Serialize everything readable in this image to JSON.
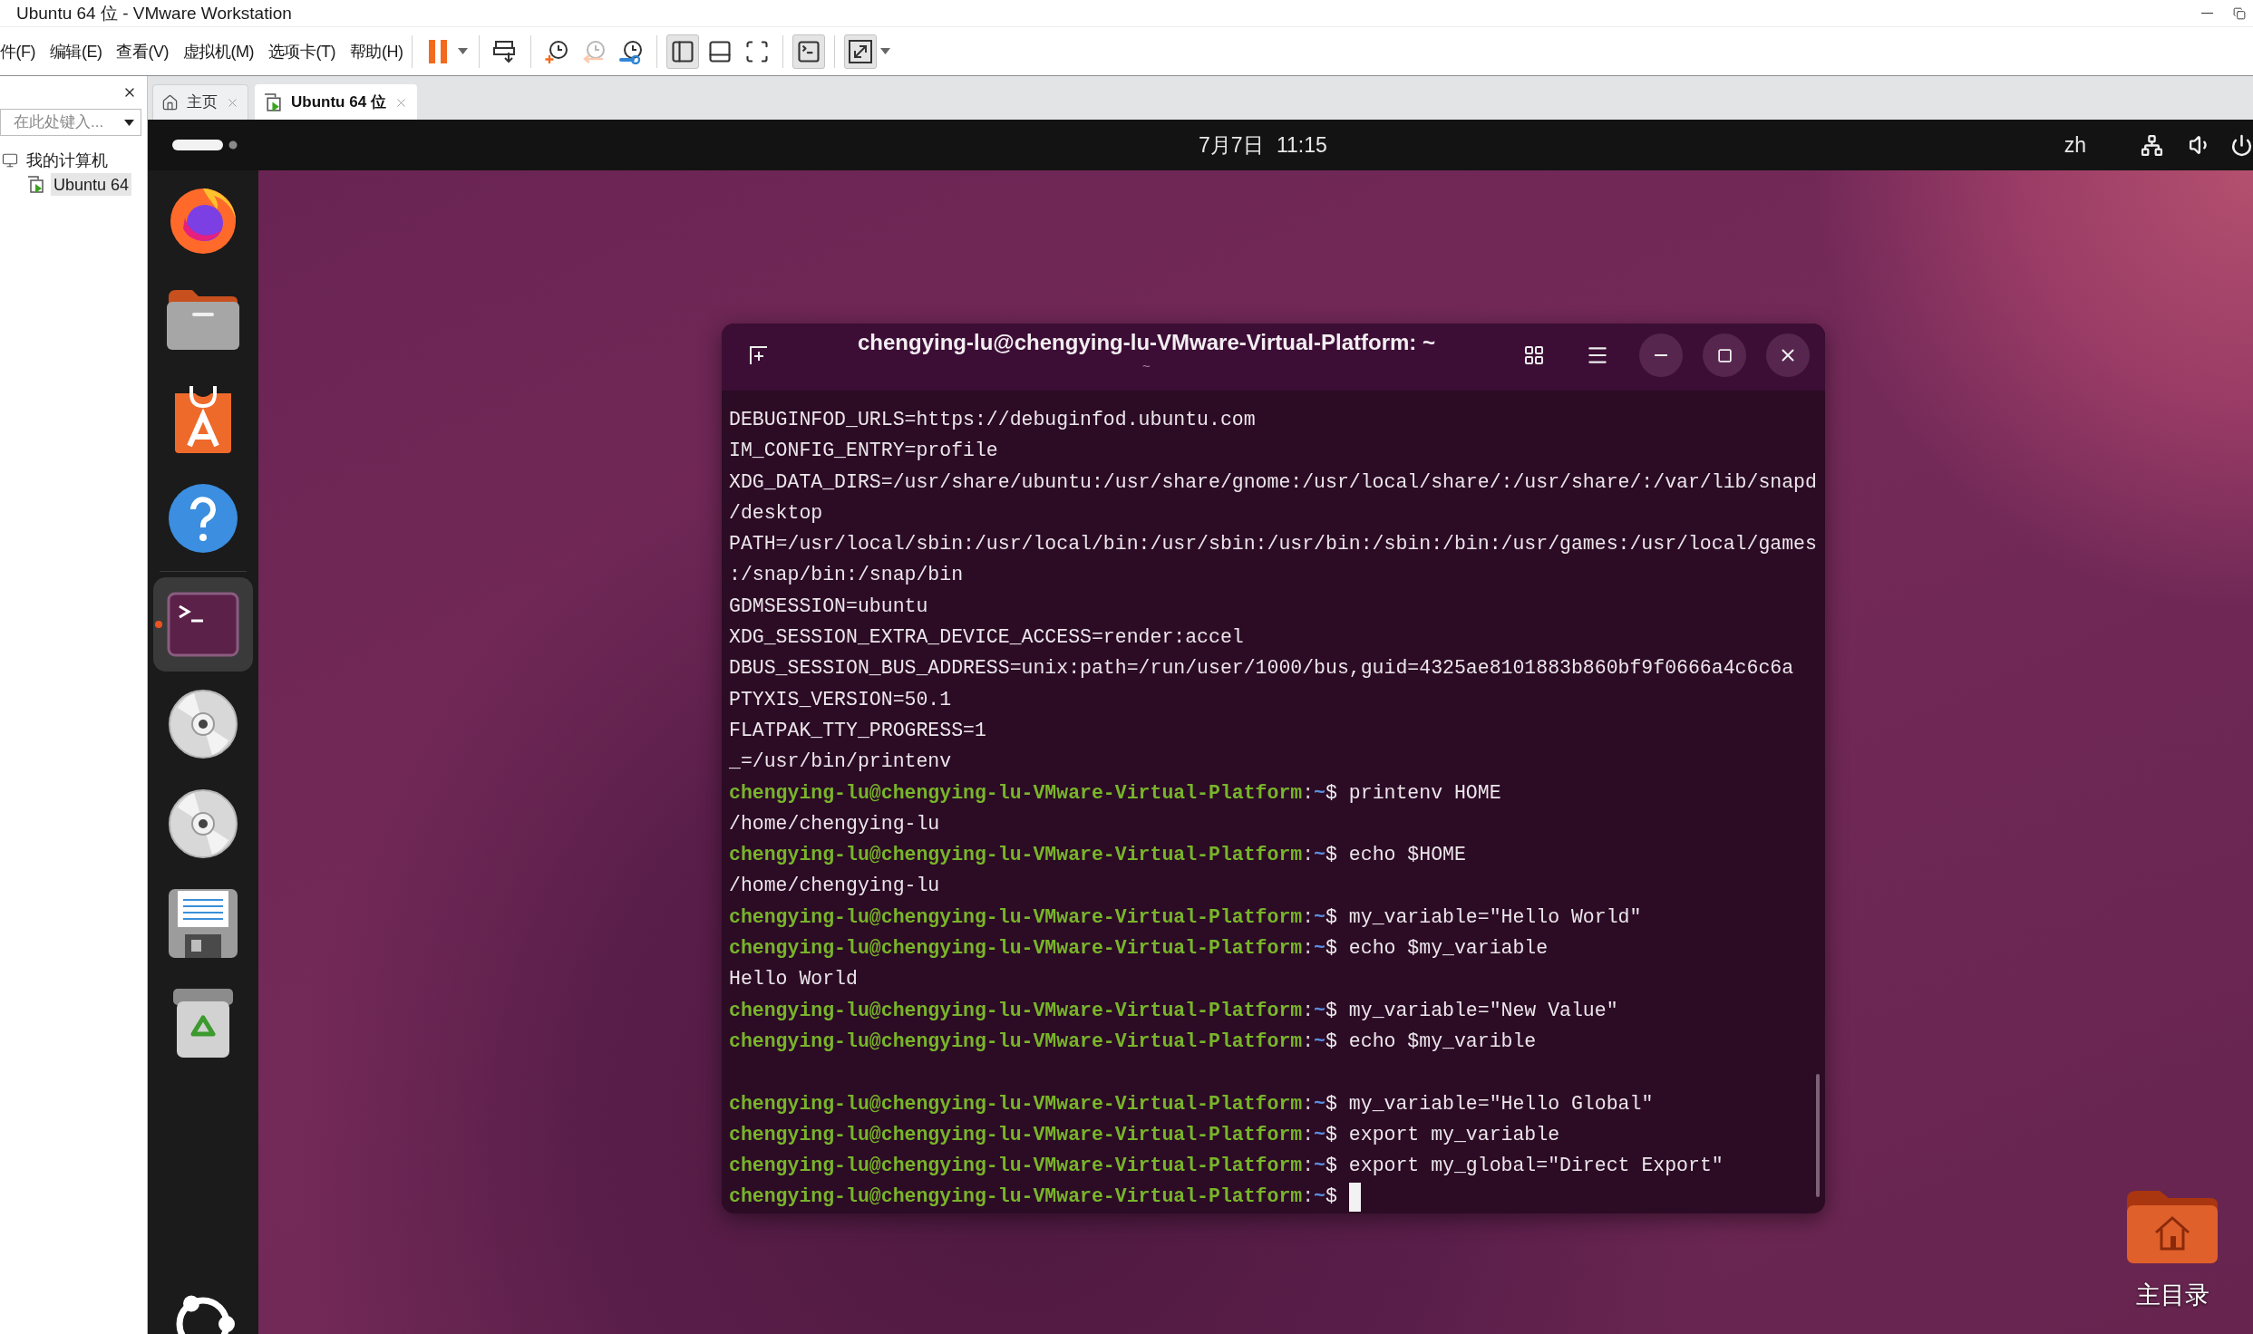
{
  "window": {
    "title": "Ubuntu 64 位 - VMware Workstation"
  },
  "menu": [
    "件(F)",
    "编辑(E)",
    "查看(V)",
    "虚拟机(M)",
    "选项卡(T)",
    "帮助(H)"
  ],
  "toolbar": {
    "groups": [
      {
        "buttons": [
          {
            "pressed": false,
            "disabled": false,
            "dropdown": true
          }
        ]
      },
      {
        "buttons": [
          {
            "pressed": false,
            "disabled": false,
            "dropdown": false
          }
        ]
      },
      {
        "buttons": [
          {
            "pressed": false,
            "disabled": false,
            "dropdown": false
          },
          {
            "pressed": false,
            "disabled": true,
            "dropdown": false
          },
          {
            "pressed": false,
            "disabled": false,
            "dropdown": false
          }
        ]
      },
      {
        "buttons": [
          {
            "pressed": true,
            "disabled": false,
            "dropdown": false
          },
          {
            "pressed": false,
            "disabled": false,
            "dropdown": false
          },
          {
            "pressed": false,
            "disabled": false,
            "dropdown": false
          }
        ]
      },
      {
        "buttons": [
          {
            "pressed": true,
            "disabled": false,
            "dropdown": false
          }
        ]
      },
      {
        "buttons": [
          {
            "pressed": true,
            "disabled": false,
            "dropdown": true
          }
        ]
      }
    ]
  },
  "library": {
    "search": {
      "placeholder": "在此处键入..."
    },
    "tree": [
      {
        "label": "我的计算机",
        "selected": false,
        "children": [
          {
            "label": "Ubuntu 64",
            "selected": true
          }
        ]
      }
    ]
  },
  "tabs": [
    {
      "label": "主页",
      "selected": false
    },
    {
      "label": "Ubuntu 64 位",
      "selected": true
    }
  ],
  "top_bar": {
    "clock": "7月7日 11:15",
    "input_method": "zh"
  },
  "dock": {
    "items": [
      {
        "focused": false,
        "running": false
      },
      {
        "focused": false,
        "running": false
      },
      {
        "focused": false,
        "running": false
      },
      {
        "focused": false,
        "running": false
      },
      {
        "focused": true,
        "running": true
      },
      {
        "focused": false,
        "running": false
      },
      {
        "focused": false,
        "running": false
      },
      {
        "focused": false,
        "running": false
      },
      {
        "focused": false,
        "running": false
      }
    ]
  },
  "terminal": {
    "title": "chengying-lu@chengying-lu-VMware-Virtual-Platform: ~",
    "subtitle": "~",
    "lines": [
      {
        "kind": "output",
        "text": "DEBUGINFOD_URLS=https://debuginfod.ubuntu.com"
      },
      {
        "kind": "output",
        "text": "IM_CONFIG_ENTRY=profile"
      },
      {
        "kind": "output",
        "text": "XDG_DATA_DIRS=/usr/share/ubuntu:/usr/share/gnome:/usr/local/share/:/usr/share/:/var/lib/snapd"
      },
      {
        "kind": "output",
        "text": "/desktop"
      },
      {
        "kind": "output",
        "text": "PATH=/usr/local/sbin:/usr/local/bin:/usr/sbin:/usr/bin:/sbin:/bin:/usr/games:/usr/local/games"
      },
      {
        "kind": "output",
        "text": ":/snap/bin:/snap/bin"
      },
      {
        "kind": "output",
        "text": "GDMSESSION=ubuntu"
      },
      {
        "kind": "output",
        "text": "XDG_SESSION_EXTRA_DEVICE_ACCESS=render:accel"
      },
      {
        "kind": "output",
        "text": "DBUS_SESSION_BUS_ADDRESS=unix:path=/run/user/1000/bus,guid=4325ae8101883b860bf9f0666a4c6c6a"
      },
      {
        "kind": "output",
        "text": "PTYXIS_VERSION=50.1"
      },
      {
        "kind": "output",
        "text": "FLATPAK_TTY_PROGRESS=1"
      },
      {
        "kind": "output",
        "text": "_=/usr/bin/printenv"
      },
      {
        "kind": "prompt",
        "user": "chengying-lu@chengying-lu-VMware-Virtual-Platform",
        "colon": ":",
        "path": "~",
        "symbol": "$",
        "command": "printenv HOME"
      },
      {
        "kind": "output",
        "text": "/home/chengying-lu"
      },
      {
        "kind": "prompt",
        "user": "chengying-lu@chengying-lu-VMware-Virtual-Platform",
        "colon": ":",
        "path": "~",
        "symbol": "$",
        "command": "echo $HOME"
      },
      {
        "kind": "output",
        "text": "/home/chengying-lu"
      },
      {
        "kind": "prompt",
        "user": "chengying-lu@chengying-lu-VMware-Virtual-Platform",
        "colon": ":",
        "path": "~",
        "symbol": "$",
        "command": "my_variable=\"Hello World\""
      },
      {
        "kind": "prompt",
        "user": "chengying-lu@chengying-lu-VMware-Virtual-Platform",
        "colon": ":",
        "path": "~",
        "symbol": "$",
        "command": "echo $my_variable"
      },
      {
        "kind": "output",
        "text": "Hello World"
      },
      {
        "kind": "prompt",
        "user": "chengying-lu@chengying-lu-VMware-Virtual-Platform",
        "colon": ":",
        "path": "~",
        "symbol": "$",
        "command": "my_variable=\"New Value\""
      },
      {
        "kind": "prompt",
        "user": "chengying-lu@chengying-lu-VMware-Virtual-Platform",
        "colon": ":",
        "path": "~",
        "symbol": "$",
        "command": "echo $my_varible"
      },
      {
        "kind": "blank"
      },
      {
        "kind": "prompt",
        "user": "chengying-lu@chengying-lu-VMware-Virtual-Platform",
        "colon": ":",
        "path": "~",
        "symbol": "$",
        "command": "my_variable=\"Hello Global\""
      },
      {
        "kind": "prompt",
        "user": "chengying-lu@chengying-lu-VMware-Virtual-Platform",
        "colon": ":",
        "path": "~",
        "symbol": "$",
        "command": "export my_variable"
      },
      {
        "kind": "prompt",
        "user": "chengying-lu@chengying-lu-VMware-Virtual-Platform",
        "colon": ":",
        "path": "~",
        "symbol": "$",
        "command": "export my_global=\"Direct Export\""
      },
      {
        "kind": "input",
        "user": "chengying-lu@chengying-lu-VMware-Virtual-Platform",
        "colon": ":",
        "path": "~",
        "symbol": "$"
      }
    ]
  },
  "desktop_icons": [
    {
      "label": "主目录"
    }
  ]
}
